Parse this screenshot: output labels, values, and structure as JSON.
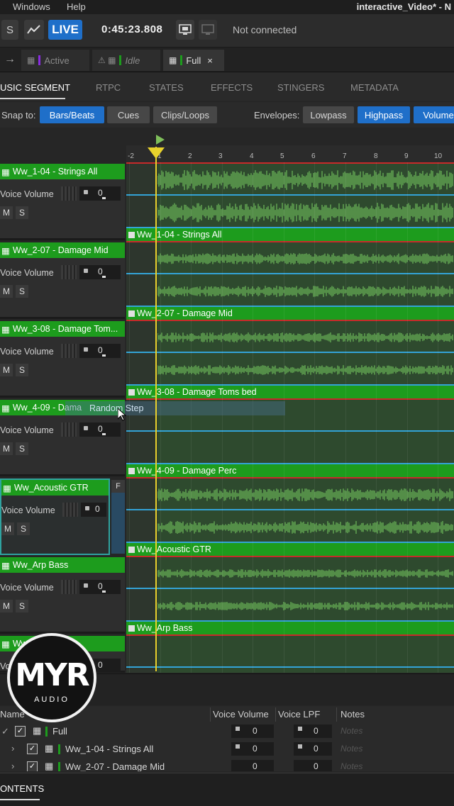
{
  "menubar": {
    "windows": "Windows",
    "help": "Help",
    "window_title": "interactive_Video* - N"
  },
  "toolbar": {
    "s_button": "S",
    "live_button": "LIVE",
    "time": "0:45:23.808",
    "connection_status": "Not connected"
  },
  "doc_tabs": [
    {
      "label": "Active",
      "color": "#8a2be2"
    },
    {
      "label": "Idle",
      "color": "#1d9c1d"
    },
    {
      "label": "Full",
      "color": "#1d9c1d",
      "close": "×"
    }
  ],
  "editor_tabs": [
    "USIC SEGMENT",
    "RTPC",
    "STATES",
    "EFFECTS",
    "STINGERS",
    "METADATA"
  ],
  "snap": {
    "label": "Snap to:",
    "options": [
      "Bars/Beats",
      "Cues",
      "Clips/Loops"
    ],
    "active": "Bars/Beats",
    "envelopes_label": "Envelopes:",
    "envelopes": [
      "Lowpass",
      "Highpass",
      "Volume"
    ]
  },
  "ruler": {
    "ticks": [
      "-2",
      "1",
      "2",
      "3",
      "4",
      "5",
      "6",
      "7",
      "8",
      "9",
      "10"
    ]
  },
  "tracks": [
    {
      "name": "Ww_1-04 - Strings All",
      "volume_label": "Voice Volume",
      "volume": "0",
      "mute": "M",
      "solo": "S",
      "segment": "Ww_1-04 - Strings All"
    },
    {
      "name": "Ww_2-07 - Damage Mid",
      "volume_label": "Voice Volume",
      "volume": "0",
      "mute": "M",
      "solo": "S",
      "segment": "Ww_2-07 - Damage Mid"
    },
    {
      "name": "Ww_3-08 - Damage Tom...",
      "volume_label": "Voice Volume",
      "volume": "0",
      "mute": "M",
      "solo": "S",
      "segment": "Ww_3-08 - Damage Toms bed"
    },
    {
      "name": "Ww_4-09 - Dama",
      "volume_label": "Voice Volume",
      "volume": "0",
      "mute": "M",
      "solo": "S",
      "segment": "Ww_4-09 - Damage Perc",
      "tooltip": "Random Step"
    },
    {
      "name": "Ww_Acoustic GTR",
      "volume_label": "Voice Volume",
      "volume": "0",
      "mute": "M",
      "solo": "S",
      "segment": "Ww_Acoustic GTR",
      "f_button": "F"
    },
    {
      "name": "Ww_Arp Bass",
      "volume_label": "Voice Volume",
      "volume": "0",
      "mute": "M",
      "solo": "S",
      "segment": "Ww_Arp Bass"
    },
    {
      "name": "Ww",
      "volume_label": "Voice Volume",
      "volume": "0"
    }
  ],
  "logo": {
    "text": "MYR",
    "subtext": "AUDIO"
  },
  "list": {
    "columns": [
      "Name",
      "Voice Volume",
      "Voice LPF",
      "Notes"
    ],
    "rows": [
      {
        "name": "Full",
        "volume": "0",
        "lpf": "0",
        "notes": "Notes"
      },
      {
        "name": "Ww_1-04 - Strings All",
        "volume": "0",
        "lpf": "0",
        "notes": "Notes"
      },
      {
        "name": "Ww_2-07 - Damage Mid",
        "volume": "0",
        "lpf": "0",
        "notes": "Notes"
      }
    ]
  },
  "bottom_tab": "ONTENTS"
}
